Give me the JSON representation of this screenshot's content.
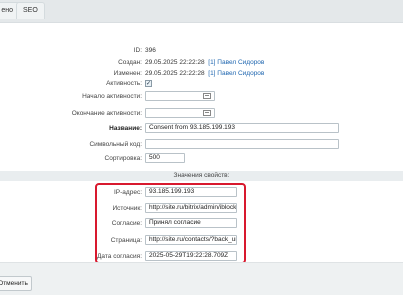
{
  "tabs": [
    "ено",
    "SEO"
  ],
  "fields": {
    "id": {
      "label": "ID:",
      "value": "396"
    },
    "created": {
      "label": "Создан:",
      "date": "29.05.2025 22:22:28",
      "user": "[1] Павел Сидоров"
    },
    "modified": {
      "label": "Изменен:",
      "date": "29.05.2025 22:22:28",
      "user": "[1] Павел Сидоров"
    },
    "active": {
      "label": "Активность:",
      "checked": "✓"
    },
    "active_from": {
      "label": "Начало активности:",
      "value": ""
    },
    "active_to": {
      "label": "Окончание активности:",
      "value": ""
    },
    "name": {
      "label": "Название:",
      "value": "Consent from 93.185.199.193"
    },
    "code": {
      "label": "Символьный код:",
      "value": ""
    },
    "sort": {
      "label": "Сортировка:",
      "value": "500"
    }
  },
  "properties": {
    "title": "Значения свойств:",
    "items": [
      {
        "label": "IP-адрес:",
        "value": "93.185.199.193"
      },
      {
        "label": "Источник:",
        "value": "http://site.ru/bitrix/admin/iblock_elemen"
      },
      {
        "label": "Согласие:",
        "value": "Принял согласие"
      },
      {
        "label": "Страница:",
        "value": "http://site.ru/contacts/?back_url_admin"
      },
      {
        "label": "Дата согласия:",
        "value": "2025-05-29T19:22:28.709Z"
      }
    ]
  },
  "footer": {
    "cancel_label": "Отменить"
  }
}
